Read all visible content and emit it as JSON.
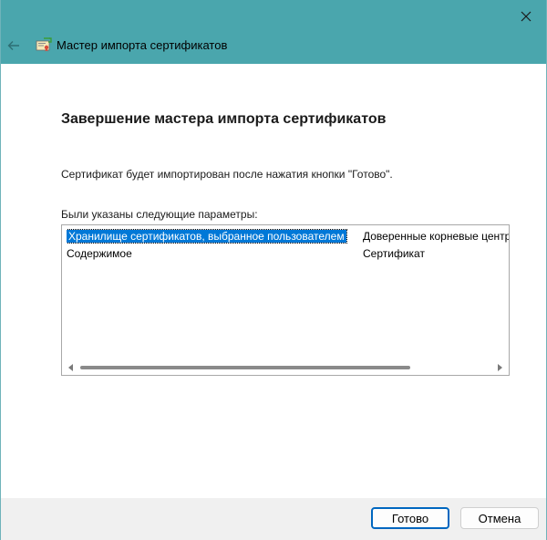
{
  "window": {
    "title": "Мастер импорта сертификатов",
    "accent_color": "#4aa6ad"
  },
  "page": {
    "heading": "Завершение мастера импорта сертификатов",
    "description": "Сертификат будет импортирован после нажатия кнопки \"Готово\".",
    "list_caption": "Были указаны следующие параметры:"
  },
  "settings_list": {
    "rows": [
      {
        "name": "Хранилище сертификатов, выбранное пользователем",
        "value": "Доверенные корневые центры сертификации",
        "selected": true
      },
      {
        "name": "Содержимое",
        "value": "Сертификат",
        "selected": false
      }
    ]
  },
  "footer": {
    "done_label": "Готово",
    "cancel_label": "Отмена"
  },
  "icons": {
    "close": "close-icon",
    "back": "back-arrow-icon",
    "app": "certificate-icon"
  }
}
